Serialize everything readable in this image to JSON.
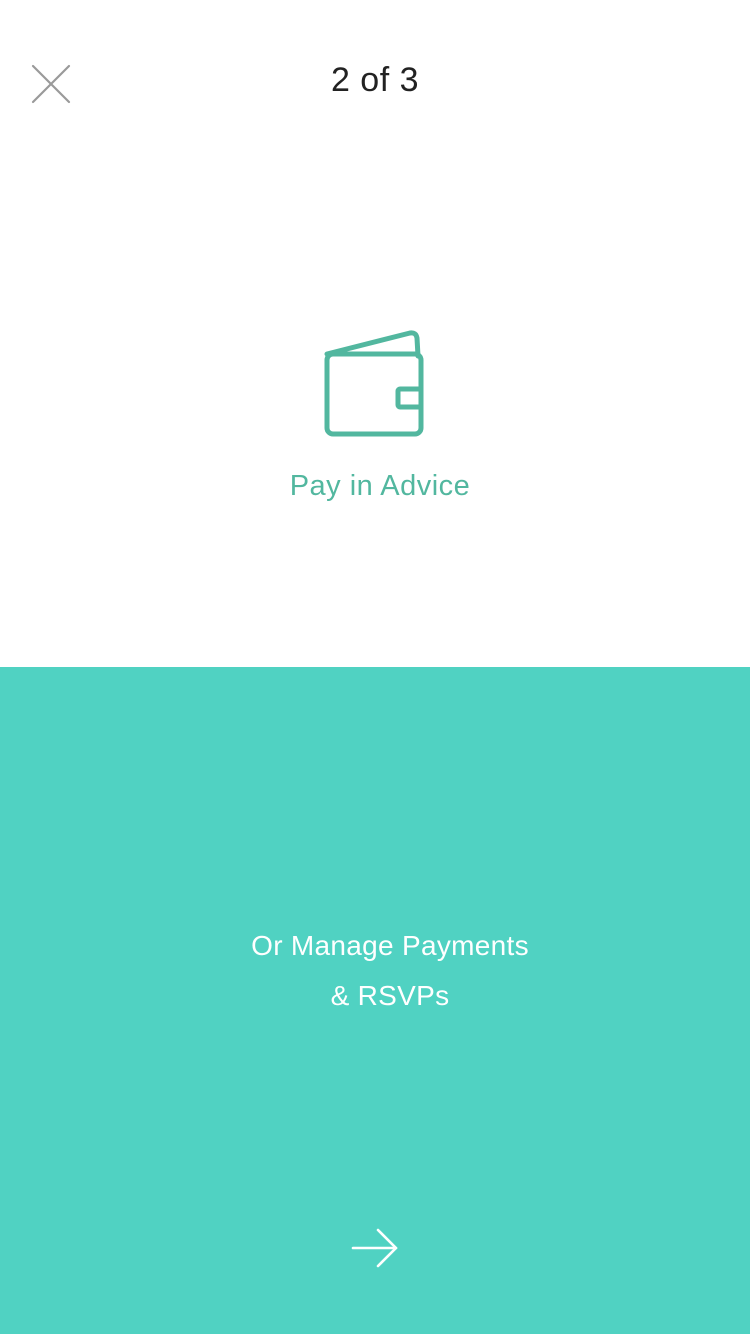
{
  "header": {
    "close_icon": "close-icon",
    "step_text": "2 of 3"
  },
  "feature": {
    "icon": "wallet-icon",
    "label": "Pay in Advice",
    "accent_color": "#52b79f"
  },
  "footer": {
    "background_color": "#50d2c2",
    "line1": "Or Manage Payments",
    "line2": "& RSVPs",
    "next_icon": "arrow-right-icon"
  }
}
